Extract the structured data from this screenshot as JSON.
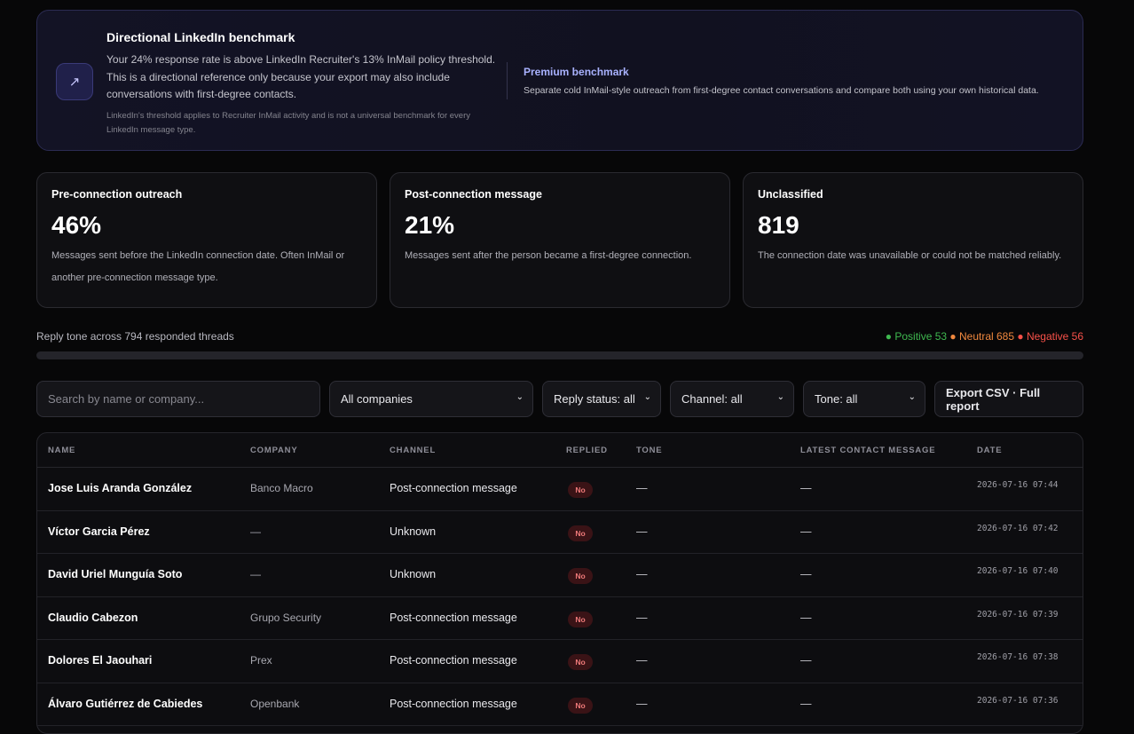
{
  "benchmark": {
    "icon": "arrow-up-right-icon",
    "title": "Directional LinkedIn benchmark",
    "text": "Your 24% response rate is above LinkedIn Recruiter's 13% InMail policy threshold. This is a directional reference only because your export may also include conversations with first-degree contacts.",
    "note": "LinkedIn's threshold applies to Recruiter InMail activity and is not a universal benchmark for every LinkedIn message type.",
    "premium_title": "Premium benchmark",
    "premium_text": "Separate cold InMail-style outreach from first-degree contact conversations and compare both using your own historical data."
  },
  "cards": [
    {
      "title": "Pre-connection outreach",
      "value": "46%",
      "desc": "Messages sent before the LinkedIn connection date. Often InMail or another pre-connection message type."
    },
    {
      "title": "Post-connection message",
      "value": "21%",
      "desc": "Messages sent after the person became a first-degree connection."
    },
    {
      "title": "Unclassified",
      "value": "819",
      "desc": "The connection date was unavailable or could not be matched reliably."
    }
  ],
  "tone": {
    "label": "Reply tone across 794 responded threads",
    "positive": "● Positive 53",
    "neutral": "● Neutral 685",
    "negative": "● Negative 56",
    "colors": {
      "positive": "#3fb950",
      "neutral": "#f0883e",
      "negative": "#f85149"
    }
  },
  "filters": {
    "search_placeholder": "Search by name or company...",
    "company": "All companies",
    "reply_status": "Reply status: all",
    "channel": "Channel: all",
    "tone": "Tone: all",
    "export": "Export CSV · Full report"
  },
  "table": {
    "headers": [
      "NAME",
      "COMPANY",
      "CHANNEL",
      "REPLIED",
      "TONE",
      "LATEST CONTACT MESSAGE",
      "DATE"
    ],
    "rows": [
      {
        "name": "Jose Luis Aranda González",
        "company": "Banco Macro",
        "channel": "Post-connection message",
        "replied": "No",
        "tone": "—",
        "latest": "—",
        "date": "2026-07-16 07:44"
      },
      {
        "name": "Víctor Garcia Pérez",
        "company": "—",
        "channel": "Unknown",
        "replied": "No",
        "tone": "—",
        "latest": "—",
        "date": "2026-07-16 07:42"
      },
      {
        "name": "David Uriel Munguía Soto",
        "company": "—",
        "channel": "Unknown",
        "replied": "No",
        "tone": "—",
        "latest": "—",
        "date": "2026-07-16 07:40"
      },
      {
        "name": "Claudio Cabezon",
        "company": "Grupo Security",
        "channel": "Post-connection message",
        "replied": "No",
        "tone": "—",
        "latest": "—",
        "date": "2026-07-16 07:39"
      },
      {
        "name": "Dolores El Jaouhari",
        "company": "Prex",
        "channel": "Post-connection message",
        "replied": "No",
        "tone": "—",
        "latest": "—",
        "date": "2026-07-16 07:38"
      },
      {
        "name": "Álvaro Gutiérrez de Cabiedes",
        "company": "Openbank",
        "channel": "Post-connection message",
        "replied": "No",
        "tone": "—",
        "latest": "—",
        "date": "2026-07-16 07:36"
      }
    ]
  }
}
